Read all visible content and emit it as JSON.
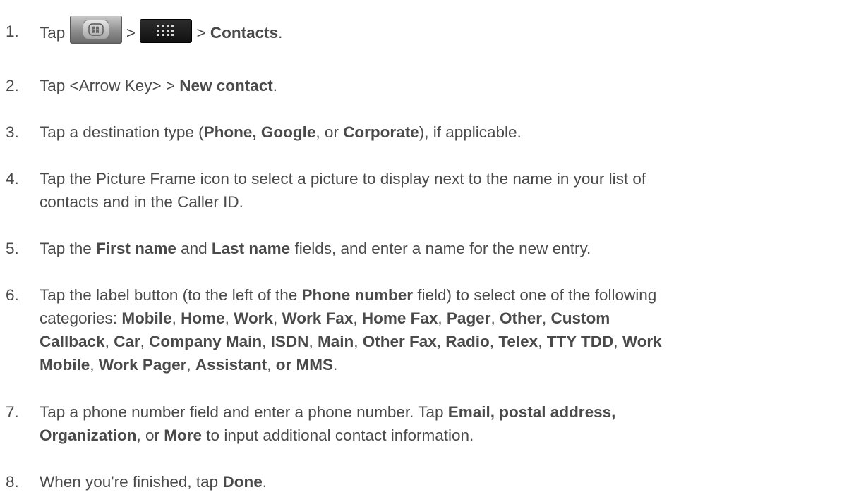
{
  "steps": [
    {
      "number": "1.",
      "tap": "Tap",
      "sep1": ">",
      "sep2": ">",
      "contacts": "Contacts",
      "end": ".",
      "home_icon": "home-key-icon",
      "apps_icon": "applications-grid-icon"
    },
    {
      "number": "2.",
      "pre": "Tap <Arrow Key> > ",
      "new_contact": "New contact",
      "end": "."
    },
    {
      "number": "3.",
      "pre": "Tap a destination type (",
      "phone_google": "Phone, Google",
      "mid": ", or ",
      "corporate": "Corporate",
      "post": "), if applicable."
    },
    {
      "number": "4.",
      "line1": "Tap the Picture Frame icon to select a picture to display next to the name in your list of",
      "line2": "contacts and in the Caller ID."
    },
    {
      "number": "5.",
      "pre": "Tap the ",
      "first_name": "First name",
      "and": " and ",
      "last_name": "Last name",
      "post": " fields, and enter a name for the new entry."
    },
    {
      "number": "6.",
      "pre": "Tap the label button (to the left of the ",
      "phone_number": "Phone number",
      "post": " field) to select one of the following",
      "categories_intro": "categories: ",
      "c": [
        "Mobile",
        "Home",
        "Work",
        "Work Fax",
        "Home Fax",
        "Pager",
        "Other",
        "Custom",
        "Callback",
        "Car",
        "Company Main",
        "ISDN",
        "Main",
        "Other Fax",
        "Radio",
        "Telex",
        "TTY TDD",
        "Work",
        "Mobile",
        "Work Pager",
        "Assistant",
        "or MMS"
      ],
      "comma": ", ",
      "end": "."
    },
    {
      "number": "7.",
      "pre": "Tap a phone number field and enter a phone number. Tap ",
      "email_postal": "Email, postal address,",
      "organization": "Organization",
      "or": ", or ",
      "more": "More",
      "post": " to input additional contact information."
    },
    {
      "number": "8.",
      "pre": "When you're finished, tap ",
      "done": "Done",
      "end": "."
    }
  ]
}
